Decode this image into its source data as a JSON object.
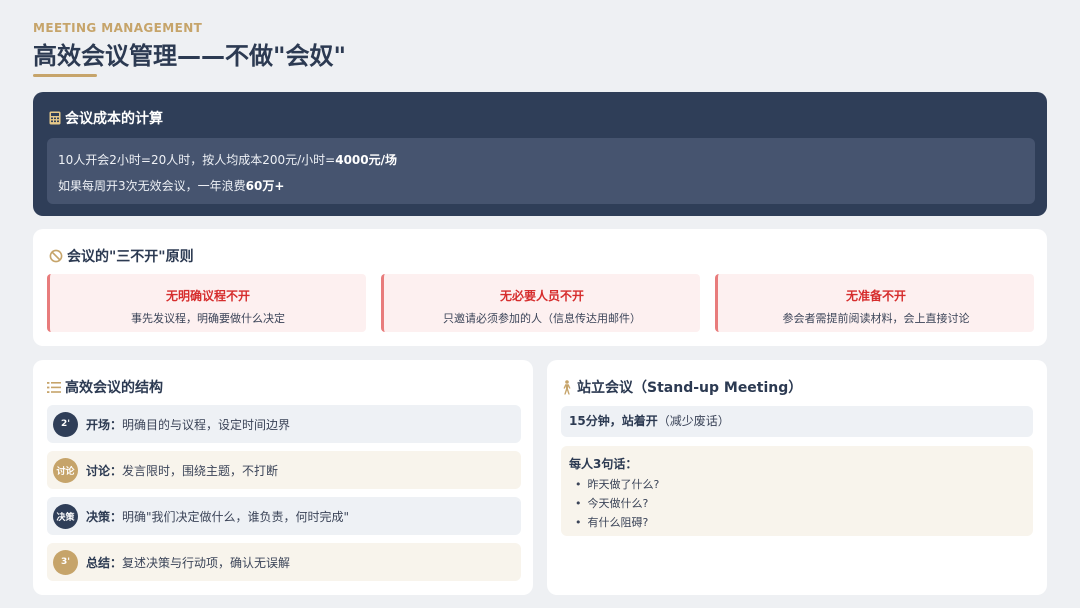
{
  "header": {
    "eyebrow": "MEETING MANAGEMENT",
    "title": "高效会议管理——不做\"会奴\""
  },
  "cost": {
    "icon": "calculator-icon",
    "title": "会议成本的计算",
    "line1_prefix": "10人开会2小时=20人时，按人均成本200元/小时=",
    "line1_bold": "4000元/场",
    "line2_prefix": "如果每周开3次无效会议，一年浪费",
    "line2_bold": "60万+"
  },
  "rules": {
    "icon": "ban-icon",
    "title": "会议的\"三不开\"原则",
    "items": [
      {
        "title": "无明确议程不开",
        "desc": "事先发议程，明确要做什么决定"
      },
      {
        "title": "无必要人员不开",
        "desc": "只邀请必须参加的人（信息传达用邮件）"
      },
      {
        "title": "无准备不开",
        "desc": "参会者需提前阅读材料，会上直接讨论"
      }
    ]
  },
  "structure": {
    "icon": "list-icon",
    "title": "高效会议的结构",
    "steps": [
      {
        "badge": "2'",
        "label": "开场",
        "sep": "：",
        "text": "明确目的与议程，设定时间边界"
      },
      {
        "badge": "讨论",
        "label": "讨论",
        "sep": "：",
        "text": "发言限时，围绕主题，不打断"
      },
      {
        "badge": "决策",
        "label": "决策",
        "sep": "：",
        "text": "明确\"我们决定做什么，谁负责，何时完成\""
      },
      {
        "badge": "3'",
        "label": "总结",
        "sep": "：",
        "text": "复述决策与行动项，确认无误解"
      }
    ]
  },
  "standup": {
    "icon": "person-standing-icon",
    "title": "站立会议（Stand-up Meeting）",
    "rule_bold": "15分钟，站着开",
    "rule_note": "（减少废话）",
    "questions_title": "每人3句话：",
    "questions": [
      "昨天做了什么?",
      "今天做什么?",
      "有什么阻碍?"
    ]
  },
  "colors": {
    "navy": "#2f3e58",
    "gold": "#c6a46a",
    "red": "#d62d2d",
    "pink_bg": "#fdf0f0"
  }
}
